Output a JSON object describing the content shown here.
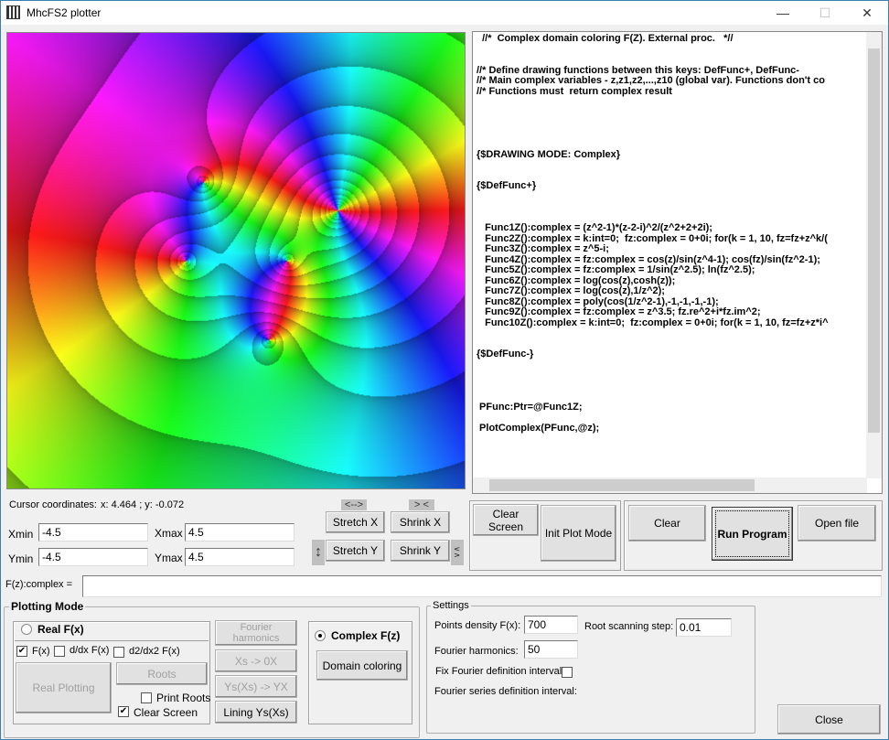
{
  "window": {
    "title": "MhcFS2 plotter",
    "minimize": "—",
    "maximize": "☐",
    "close": "✕"
  },
  "editor": {
    "lines": [
      "  //*  Complex domain coloring F(Z). External proc.   *//",
      "",
      "",
      "//* Define drawing functions between this keys: DefFunc+, DefFunc-",
      "//* Main complex variables - z,z1,z2,...,z10 (global var). Functions don't co",
      "//* Functions must  return complex result",
      "",
      "",
      "",
      "",
      "",
      "{$DRAWING MODE: Complex}",
      "",
      "",
      "{$DefFunc+}",
      "",
      "",
      "",
      "   Func1Z():complex = (z^2-1)*(z-2-i)^2/(z^2+2+2i);",
      "   Func2Z():complex = k:int=0;  fz:complex = 0+0i; for(k = 1, 10, fz=fz+z^k/(",
      "   Func3Z():complex = z^5-i;",
      "   Func4Z():complex = fz:complex = cos(z)/sin(z^4-1); cos(fz)/sin(fz^2-1);",
      "   Func5Z():complex = fz:complex = 1/sin(z^2.5); ln(fz^2.5);",
      "   Func6Z():complex = log(cos(z),cosh(z));",
      "   Func7Z():complex = log(cos(z),1/z^2);",
      "   Func8Z():complex = poly(cos(1/z^2-1),-1,-1,-1,-1);",
      "   Func9Z():complex = fz:complex = z^3.5; fz.re^2+i*fz.im^2;",
      "   Func10Z():complex = k:int=0;  fz:complex = 0+0i; for(k = 1, 10, fz=fz+z*i^",
      "",
      "",
      "{$DefFunc-}",
      "",
      "",
      "",
      "",
      " PFunc:Ptr=@Func1Z;",
      "",
      " PlotComplex(PFunc,@z);"
    ]
  },
  "cursor": {
    "label": "Cursor  coordinates:",
    "value": "x: 4.464 ; y: -0.072"
  },
  "range": {
    "xmin_label": "Xmin",
    "xmin": "-4.5",
    "xmax_label": "Xmax",
    "xmax": "4.5",
    "ymin_label": "Ymin",
    "ymin": "-4.5",
    "ymax_label": "Ymax",
    "ymax": "4.5"
  },
  "zoom": {
    "stretch_x": "Stretch X",
    "shrink_x": "Shrink X",
    "stretch_y": "Stretch Y",
    "shrink_y": "Shrink Y",
    "stretch_x_icon": "<-->",
    "shrink_x_icon": "> <",
    "stretch_y_icon": "↕",
    "shrink_y_icon": "∨∧"
  },
  "actions": {
    "clear_screen": "Clear Screen",
    "init_plot_mode": "Init Plot Mode",
    "clear": "Clear",
    "run_program": "Run Program",
    "open_file": "Open file"
  },
  "function_input": {
    "label": "F(z):complex =",
    "value": ""
  },
  "plotting_mode": {
    "title": "Plotting Mode",
    "real_label": "Real   F(x)",
    "fx": "F(x)",
    "dfx": "d/dx F(x)",
    "d2fx": "d2/dx2 F(x)",
    "real_plotting": "Real Plotting",
    "roots": "Roots",
    "print_roots": "Print Roots",
    "clear_screen": "Clear Screen",
    "fourier_harmonics": "Fourier harmonics",
    "xs_0x": "Xs -> 0X",
    "ys_yx": "Ys(Xs) -> YX",
    "lining": "Lining Ys(Xs)",
    "complex_label": "Complex  F(z)",
    "domain_coloring": "Domain coloring"
  },
  "settings": {
    "title": "Settings",
    "points_density_label": "Points density F(x):",
    "points_density": "700",
    "root_step_label": "Root scanning step:",
    "root_step": "0.01",
    "fourier_harmonics_label": "Fourier harmonics:",
    "fourier_harmonics": "50",
    "fix_interval_label": "Fix Fourier definition interval:",
    "series_interval_label": "Fourier series definition interval:"
  },
  "close_button": "Close"
}
